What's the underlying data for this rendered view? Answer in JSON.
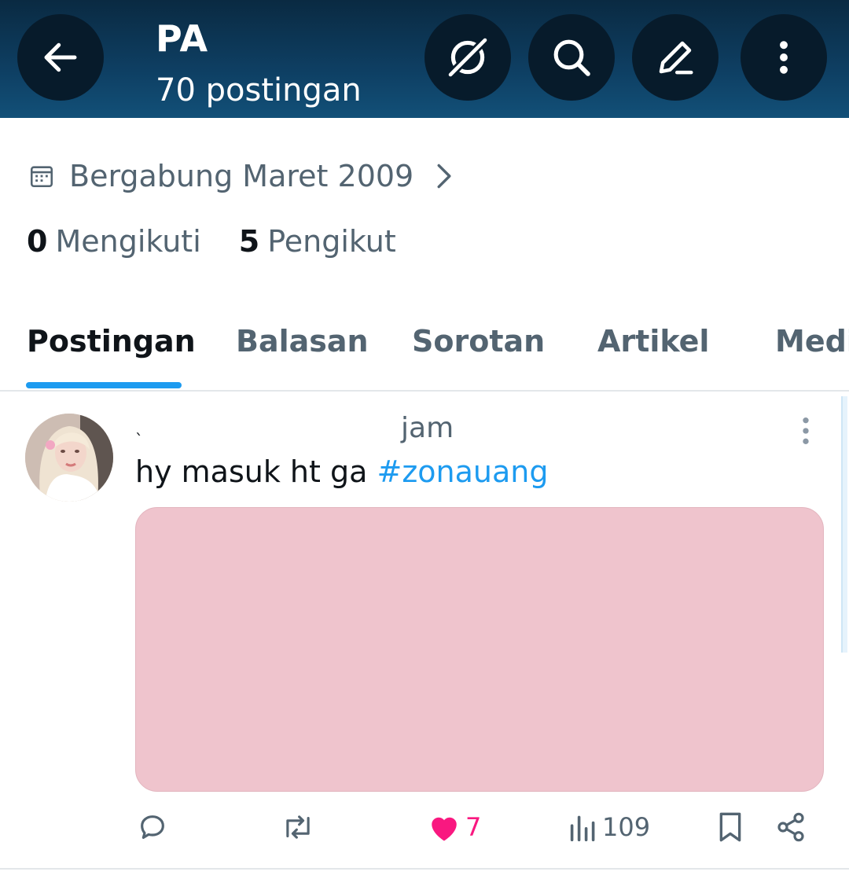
{
  "header": {
    "title": "PA",
    "subtitle": "70 postingan",
    "icons": [
      "back-arrow-icon",
      "grok-icon",
      "search-icon",
      "compose-icon",
      "more-vertical-icon"
    ]
  },
  "profile": {
    "joined": "Bergabung Maret 2009",
    "following_count": "0",
    "following_label": "Mengikuti",
    "followers_count": "5",
    "followers_label": "Pengikut"
  },
  "tabs": [
    {
      "label": "Postingan",
      "active": true
    },
    {
      "label": "Balasan",
      "active": false
    },
    {
      "label": "Sorotan",
      "active": false
    },
    {
      "label": "Artikel",
      "active": false
    },
    {
      "label": "Medi",
      "active": false
    }
  ],
  "post": {
    "name": "ˎ",
    "time": "jam",
    "text": "hy masuk ht ga ",
    "hashtag": "#zonauang",
    "actions": {
      "like_count": "7",
      "views_count": "109"
    }
  },
  "colors": {
    "header_bg": "#0e3f63",
    "accent": "#1d9bf0",
    "like": "#f91880",
    "muted": "#536471",
    "media_bg": "#efc4cd"
  }
}
